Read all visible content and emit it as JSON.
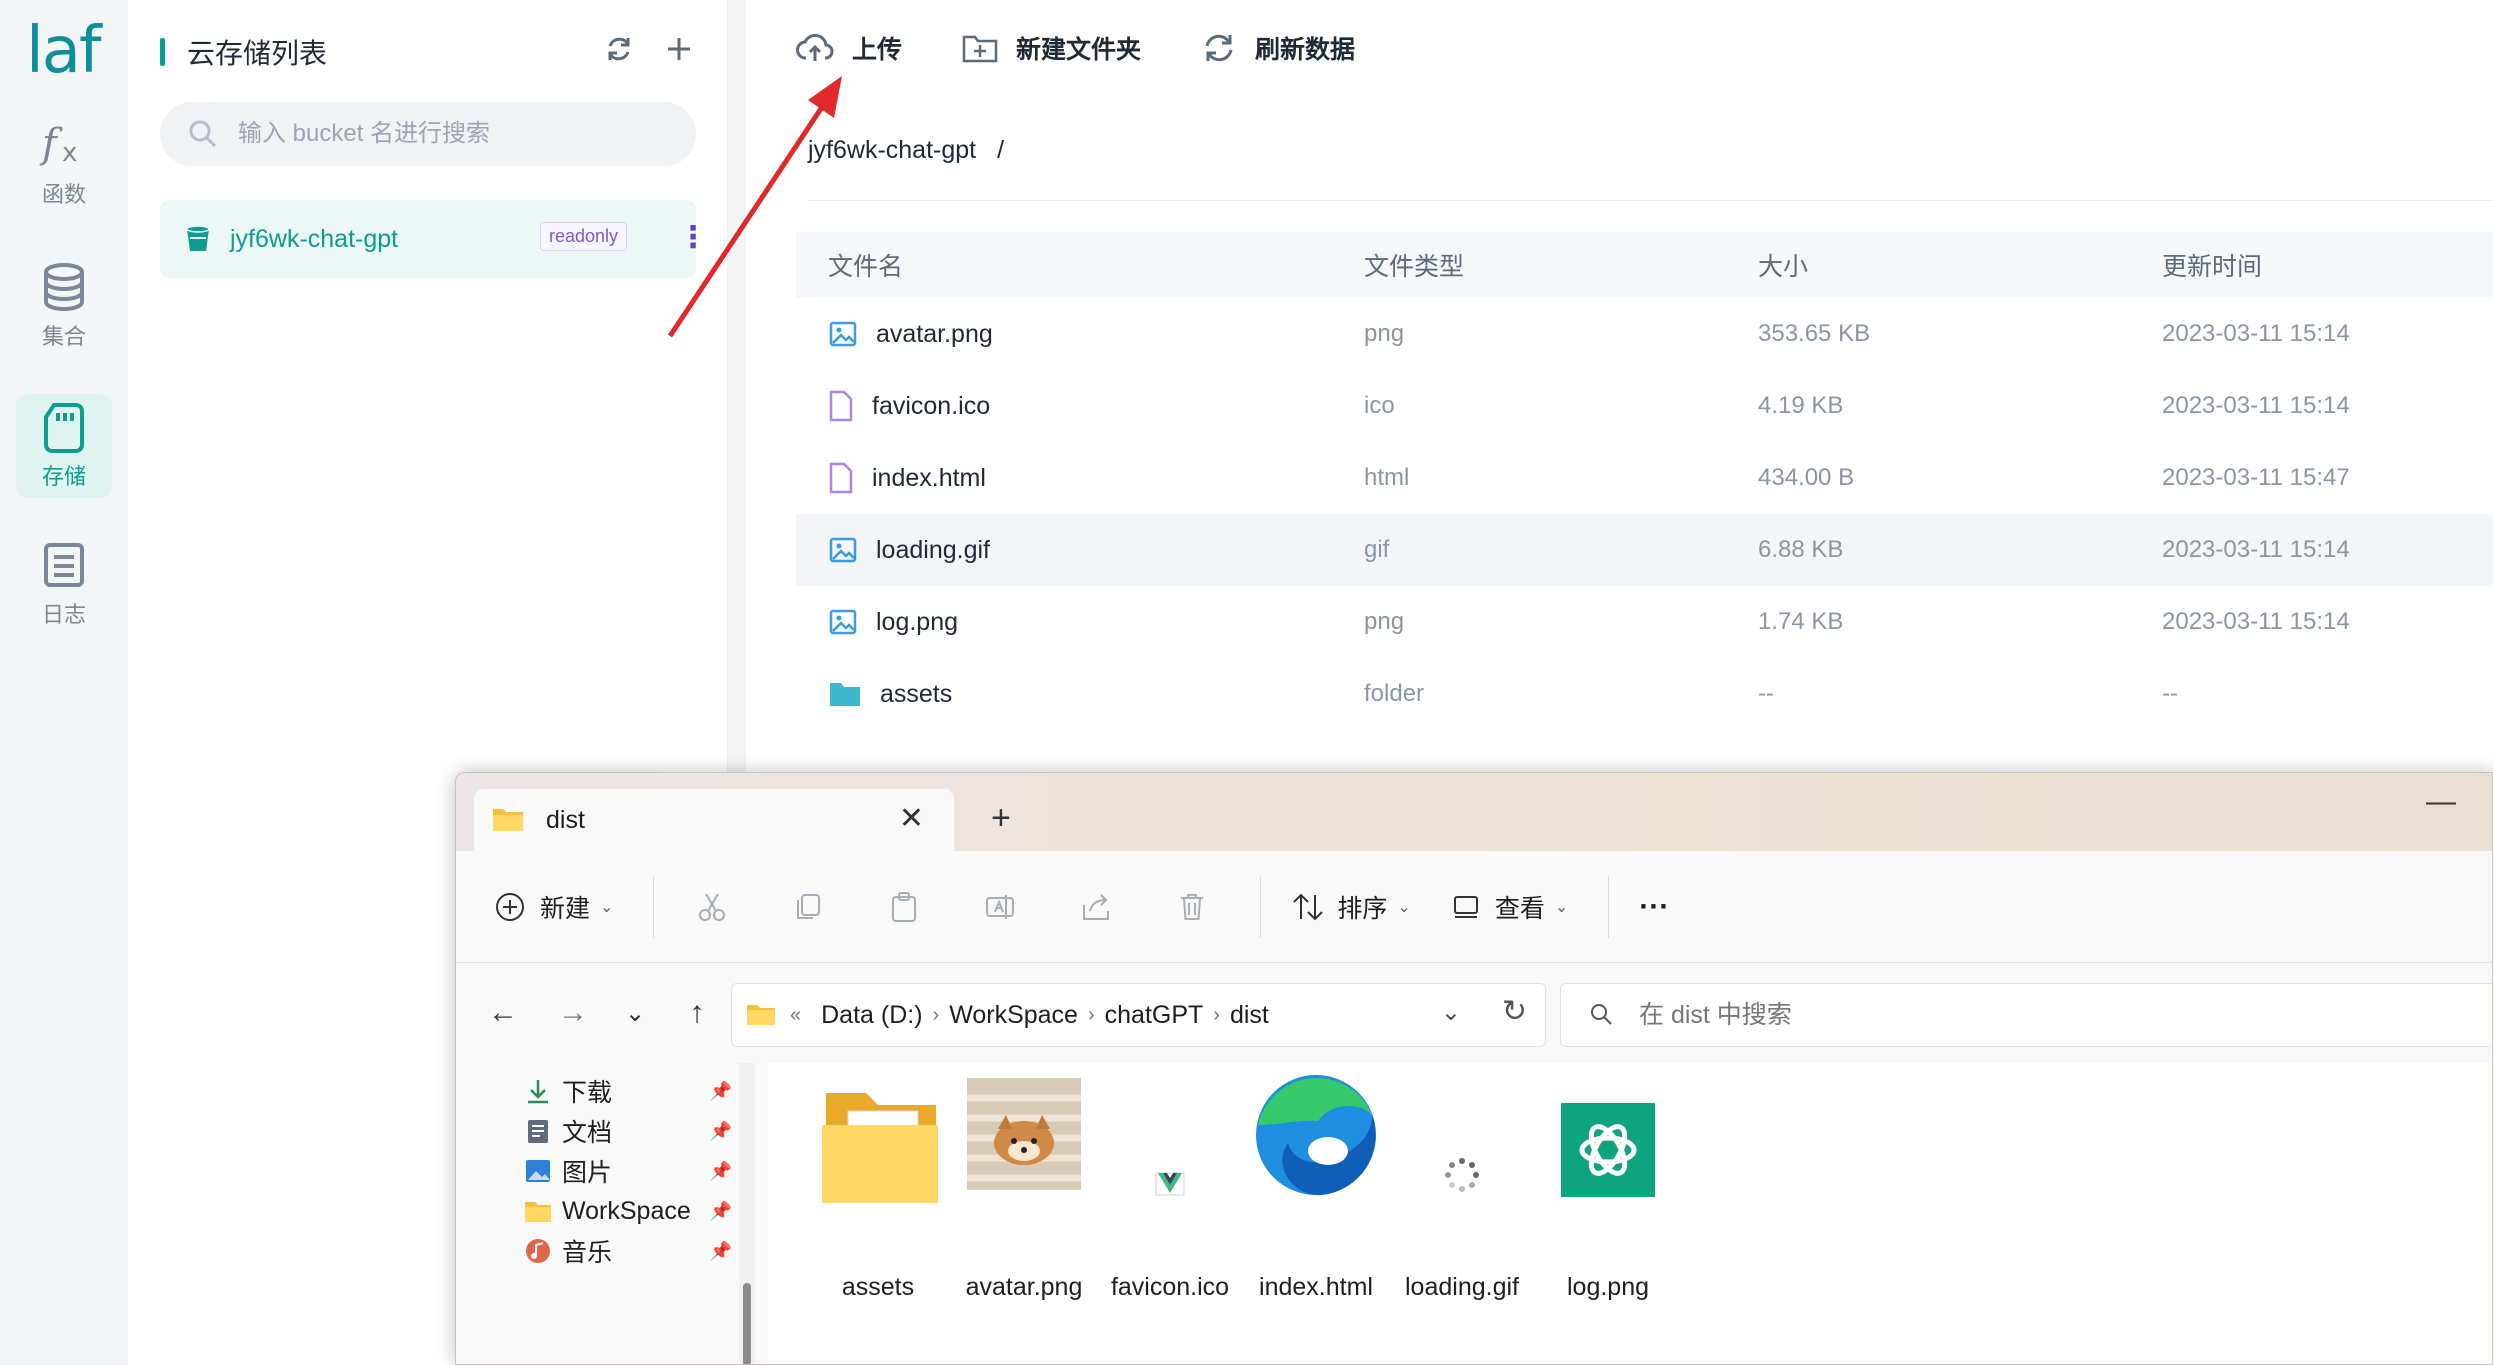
{
  "rail": {
    "logo": "laf",
    "items": [
      {
        "label": "函数",
        "icon": "function-icon"
      },
      {
        "label": "集合",
        "icon": "database-icon"
      },
      {
        "label": "存储",
        "icon": "sd-card-icon"
      },
      {
        "label": "日志",
        "icon": "log-icon"
      }
    ],
    "active_index": 2
  },
  "bucket_panel": {
    "title": "云存储列表",
    "search_placeholder": "输入 bucket 名进行搜索",
    "buckets": [
      {
        "name": "jyf6wk-chat-gpt",
        "badge": "readonly"
      }
    ]
  },
  "storage": {
    "toolbar": {
      "upload": "上传",
      "new_folder": "新建文件夹",
      "refresh": "刷新数据"
    },
    "breadcrumb": {
      "bucket": "jyf6wk-chat-gpt",
      "separator": "/"
    },
    "columns": [
      "文件名",
      "文件类型",
      "大小",
      "更新时间"
    ],
    "files": [
      {
        "name": "avatar.png",
        "type": "png",
        "size": "353.65 KB",
        "updated": "2023-03-11 15:14",
        "icon": "image-icon"
      },
      {
        "name": "favicon.ico",
        "type": "ico",
        "size": "4.19 KB",
        "updated": "2023-03-11 15:14",
        "icon": "file-icon"
      },
      {
        "name": "index.html",
        "type": "html",
        "size": "434.00 B",
        "updated": "2023-03-11 15:47",
        "icon": "file-icon"
      },
      {
        "name": "loading.gif",
        "type": "gif",
        "size": "6.88 KB",
        "updated": "2023-03-11 15:14",
        "icon": "image-icon"
      },
      {
        "name": "log.png",
        "type": "png",
        "size": "1.74 KB",
        "updated": "2023-03-11 15:14",
        "icon": "image-icon"
      },
      {
        "name": "assets",
        "type": "folder",
        "size": "--",
        "updated": "--",
        "icon": "folder-icon"
      }
    ],
    "highlighted_row": 3
  },
  "explorer": {
    "tab_title": "dist",
    "commands": {
      "new": "新建",
      "sort": "排序",
      "view": "查看",
      "more": "···"
    },
    "address": {
      "overflow": "«",
      "parts": [
        "Data (D:)",
        "WorkSpace",
        "chatGPT",
        "dist"
      ]
    },
    "search_placeholder": "在 dist 中搜索",
    "sidebar": [
      {
        "label": "下载",
        "icon": "download-icon"
      },
      {
        "label": "文档",
        "icon": "document-icon"
      },
      {
        "label": "图片",
        "icon": "pictures-icon"
      },
      {
        "label": "WorkSpace",
        "icon": "folder-icon"
      },
      {
        "label": "音乐",
        "icon": "music-icon"
      }
    ],
    "files": [
      {
        "label": "assets",
        "icon": "folder-icon"
      },
      {
        "label": "avatar.png",
        "icon": "dog-photo-thumbnail"
      },
      {
        "label": "favicon.ico",
        "icon": "vue-logo-icon"
      },
      {
        "label": "index.html",
        "icon": "edge-browser-icon"
      },
      {
        "label": "loading.gif",
        "icon": "spinner-icon"
      },
      {
        "label": "log.png",
        "icon": "chatgpt-logo-icon"
      }
    ]
  },
  "colors": {
    "brand": "#0a9f8e",
    "annotation_arrow": "#e0292b"
  }
}
